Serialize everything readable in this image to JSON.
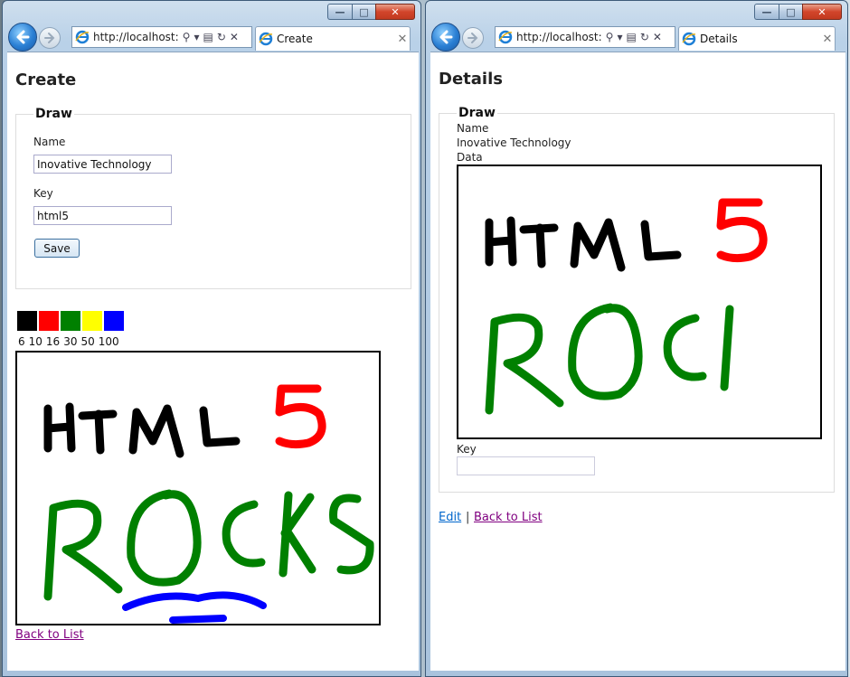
{
  "window_left": {
    "address": "http://localhost:",
    "tab_title": "Create",
    "page_title": "Create",
    "legend": "Draw",
    "name_label": "Name",
    "name_value": "Inovative Technology",
    "key_label": "Key",
    "key_value": "html5",
    "save_label": "Save",
    "colors": [
      "#000000",
      "#ff0000",
      "#008000",
      "#ffff00",
      "#0000ff"
    ],
    "brush_sizes": [
      "6",
      "10",
      "16",
      "30",
      "50",
      "100"
    ],
    "back_link": "Back to List"
  },
  "window_right": {
    "address": "http://localhost:",
    "tab_title": "Details",
    "page_title": "Details",
    "legend": "Draw",
    "name_label": "Name",
    "name_value": "Inovative Technology",
    "data_label": "Data",
    "key_label": "Key",
    "key_value": "",
    "edit_link": "Edit",
    "separator": "|",
    "back_link": "Back to List"
  },
  "drawing_left": {
    "black_text": "HTML",
    "red_text": "5",
    "green_text": "ROCKS"
  },
  "drawing_right": {
    "black_text": "HTML",
    "red_text": "5",
    "green_text": "ROCI"
  }
}
